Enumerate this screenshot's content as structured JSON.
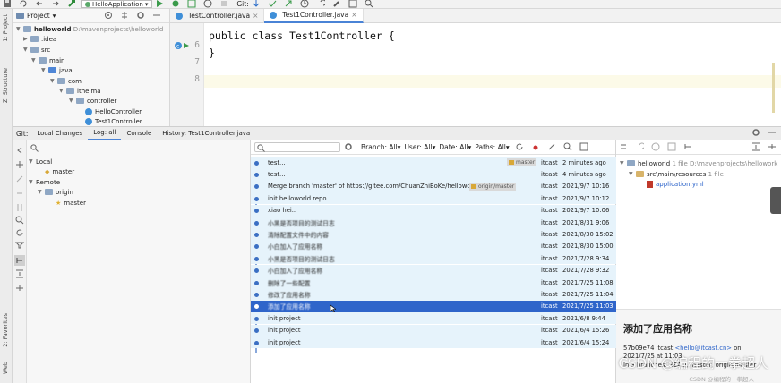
{
  "toolbar": {
    "run_config": "HelloApplication",
    "git_label": "Git:"
  },
  "left_strip": {
    "project": "1: Project",
    "structure": "Z: Structure",
    "favorites": "2: Favorites",
    "web": "Web"
  },
  "project": {
    "title": "Project",
    "tree": [
      {
        "label": "helloworld",
        "path": "D:\\mavenprojects\\helloworld",
        "indent": 0,
        "kind": "root"
      },
      {
        "label": ".idea",
        "indent": 1,
        "kind": "folder"
      },
      {
        "label": "src",
        "indent": 1,
        "kind": "folder"
      },
      {
        "label": "main",
        "indent": 2,
        "kind": "folder"
      },
      {
        "label": "java",
        "indent": 3,
        "kind": "folder-blue"
      },
      {
        "label": "com",
        "indent": 4,
        "kind": "folder"
      },
      {
        "label": "itheima",
        "indent": 5,
        "kind": "folder"
      },
      {
        "label": "controller",
        "indent": 6,
        "kind": "folder"
      },
      {
        "label": "HelloController",
        "indent": 7,
        "kind": "class"
      },
      {
        "label": "Test1Controller",
        "indent": 7,
        "kind": "class"
      }
    ]
  },
  "editor": {
    "tabs": [
      {
        "label": "TestController.java",
        "active": false
      },
      {
        "label": "Test1Controller.java",
        "active": true
      }
    ],
    "lines": [
      {
        "num": "6",
        "code": "public class Test1Controller {"
      },
      {
        "num": "7",
        "code": "}"
      },
      {
        "num": "8",
        "code": ""
      }
    ]
  },
  "git_panel": {
    "label": "Git:",
    "tabs": [
      {
        "label": "Local Changes",
        "active": false
      },
      {
        "label": "Log: all",
        "active": true
      },
      {
        "label": "Console",
        "active": false
      },
      {
        "label": "History: Test1Controller.java",
        "active": false
      }
    ]
  },
  "branches": {
    "local": "Local",
    "local_items": [
      "master"
    ],
    "remote": "Remote",
    "remote_group": "origin",
    "remote_items": [
      "master"
    ]
  },
  "log": {
    "filters": {
      "branch": "Branch: All",
      "user": "User: All",
      "date": "Date: All",
      "paths": "Paths: All"
    },
    "commits": [
      {
        "msg": "test...",
        "tag": "master",
        "author": "itcast",
        "date": "2 minutes ago",
        "selected": false,
        "cjk": false
      },
      {
        "msg": "test...",
        "tag": "",
        "author": "itcast",
        "date": "4 minutes ago",
        "selected": false,
        "cjk": false
      },
      {
        "msg": "Merge branch 'master' of https://gitee.com/ChuanZhiBoKe/helloworld my m",
        "tag": "origin/master",
        "author": "itcast",
        "date": "2021/9/7 10:16",
        "selected": false,
        "cjk": false
      },
      {
        "msg": "init helloworld repo",
        "tag": "",
        "author": "itcast",
        "date": "2021/9/7 10:12",
        "selected": false,
        "cjk": false
      },
      {
        "msg": "xiao hei..",
        "tag": "",
        "author": "itcast",
        "date": "2021/9/7 10:06",
        "selected": false,
        "cjk": false
      },
      {
        "msg": "小黑是否项目的测试日志",
        "tag": "",
        "author": "itcast",
        "date": "2021/8/31 9:06",
        "selected": false,
        "cjk": true
      },
      {
        "msg": "清除配置文件中的内容",
        "tag": "",
        "author": "itcast",
        "date": "2021/8/30 15:02",
        "selected": false,
        "cjk": true
      },
      {
        "msg": "小白加入了应用名称",
        "tag": "",
        "author": "itcast",
        "date": "2021/8/30 15:00",
        "selected": false,
        "cjk": true
      },
      {
        "msg": "小黑是否项目的测试日志",
        "tag": "",
        "author": "itcast",
        "date": "2021/7/28 9:34",
        "selected": false,
        "cjk": true
      },
      {
        "msg": "小白加入了应用名称",
        "tag": "",
        "author": "itcast",
        "date": "2021/7/28 9:32",
        "selected": false,
        "cjk": true
      },
      {
        "msg": "删除了一些配置",
        "tag": "",
        "author": "itcast",
        "date": "2021/7/25 11:08",
        "selected": false,
        "cjk": true
      },
      {
        "msg": "修改了应用名称",
        "tag": "",
        "author": "itcast",
        "date": "2021/7/25 11:04",
        "selected": false,
        "cjk": true
      },
      {
        "msg": "添加了应用名称",
        "tag": "",
        "author": "itcast",
        "date": "2021/7/25 11:03",
        "selected": true,
        "cjk": true
      },
      {
        "msg": "init project",
        "tag": "",
        "author": "itcast",
        "date": "2021/6/8 9:44",
        "selected": false,
        "cjk": false
      },
      {
        "msg": "init project",
        "tag": "",
        "author": "itcast",
        "date": "2021/6/4 15:26",
        "selected": false,
        "cjk": false
      },
      {
        "msg": "init project",
        "tag": "",
        "author": "itcast",
        "date": "2021/6/4 15:24",
        "selected": false,
        "cjk": false
      }
    ]
  },
  "changes": {
    "root": "helloworld",
    "root_meta": "1 file",
    "root_path": "D:\\mavenprojects\\hellowork",
    "folder": "src\\main\\resources",
    "folder_meta": "1 file",
    "file": "application.yml"
  },
  "detail": {
    "title": "添加了应用名称",
    "hash": "57b09e74",
    "author": "itcast",
    "email": "<hello@itcast.cn>",
    "on": "on",
    "date": "2021/7/25 at 11:03",
    "branches_line": "In 3 branches: HEAD, master, origin/master"
  },
  "watermark": {
    "main": "CSDN @编程的一拳超人",
    "sub": "CSDN @编程的一拳超人"
  }
}
